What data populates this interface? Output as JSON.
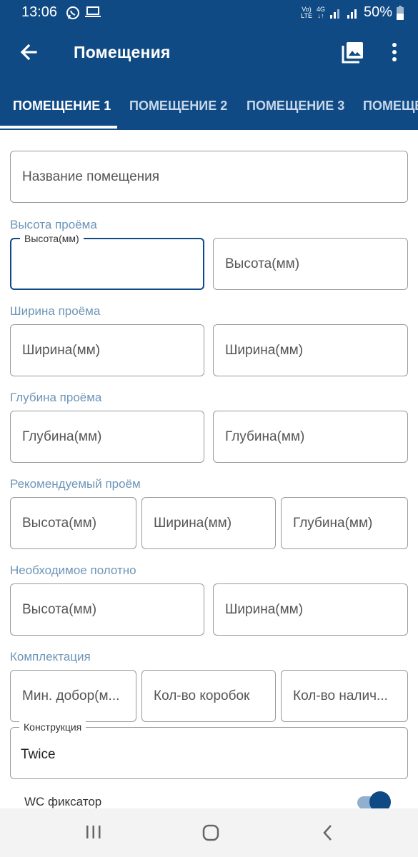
{
  "status_bar": {
    "time": "13:06",
    "network_top": "Vo)",
    "network_bottom": "LTE",
    "g4_top": "4G",
    "g4_bottom": "↓↑",
    "battery": "50%"
  },
  "app_bar": {
    "title": "Помещения",
    "icons": [
      "arrow-back-icon",
      "gallery-icon",
      "more-vert-icon"
    ]
  },
  "tabs": [
    {
      "label": "ПОМЕЩЕНИЕ 1",
      "active": true
    },
    {
      "label": "ПОМЕЩЕНИЕ 2",
      "active": false
    },
    {
      "label": "ПОМЕЩЕНИЕ 3",
      "active": false
    },
    {
      "label": "ПОМЕЩЕ",
      "active": false
    }
  ],
  "form": {
    "room_name_placeholder": "Название помещения",
    "opening_height": {
      "section": "Высота проёма",
      "floating_label": "Высота(мм)",
      "placeholder_2": "Высота(мм)"
    },
    "opening_width": {
      "section": "Ширина проёма",
      "placeholder_1": "Ширина(мм)",
      "placeholder_2": "Ширина(мм)"
    },
    "opening_depth": {
      "section": "Глубина проёма",
      "placeholder_1": "Глубина(мм)",
      "placeholder_2": "Глубина(мм)"
    },
    "recommended_opening": {
      "section": "Рекомендуемый проём",
      "height": "Высота(мм)",
      "width": "Ширина(мм)",
      "depth": "Глубина(мм)"
    },
    "required_leaf": {
      "section": "Необходимое полотно",
      "height": "Высота(мм)",
      "width": "Ширина(мм)"
    },
    "equipment": {
      "section": "Комплектация",
      "min_extension": "Мин. добор(м...",
      "box_count": "Кол-во коробок",
      "casing_count": "Кол-во налич..."
    },
    "construction": {
      "label": "Конструкция",
      "value": "Twice"
    },
    "wc_lock": {
      "label": "WC фиксатор",
      "on": true
    }
  },
  "colors": {
    "primary": "#0f4a84",
    "section_label": "#6d95b8"
  }
}
